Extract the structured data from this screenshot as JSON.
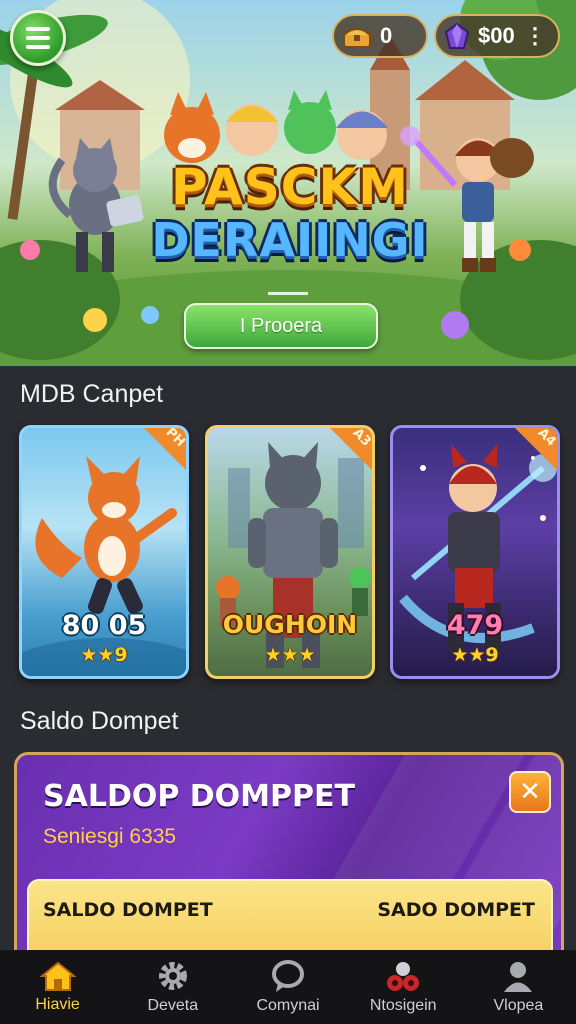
{
  "header": {
    "currency_gold": {
      "icon": "treasure-chest-icon",
      "value": "0"
    },
    "currency_gem": {
      "icon": "gem-icon",
      "value": "$00"
    },
    "more_icon": "more-vertical-icon",
    "menu_icon": "hamburger-menu-icon"
  },
  "hero": {
    "title_line1": "PASCKM",
    "title_line2": "DERAIINGI",
    "cta_label": "I Prooera"
  },
  "section1": {
    "title": "MDB Canpet",
    "cards": [
      {
        "badge": "PH",
        "value": "80 05",
        "rating_text": "★★9",
        "character": "fox-hero"
      },
      {
        "badge": "A3",
        "value": "OUGHOIN",
        "rating_text": "★★★",
        "character": "armored-knight"
      },
      {
        "badge": "A4",
        "value": "479",
        "rating_text": "★★9",
        "character": "fire-warrior"
      }
    ]
  },
  "section2": {
    "title": "Saldo Dompet"
  },
  "wallet": {
    "title": "SALDOP DOMPPET",
    "subtitle": "Seniesgi 6335",
    "close_icon": "close-x-icon",
    "inner_left": "SALDO DOMPET",
    "inner_right": "SADO DOMPET"
  },
  "bottom_nav": [
    {
      "label": "Hiavie",
      "icon": "home-icon",
      "active": true
    },
    {
      "label": "Deveta",
      "icon": "gear-icon",
      "active": false
    },
    {
      "label": "Comynai",
      "icon": "chat-bubble-icon",
      "active": false
    },
    {
      "label": "Ntosigein",
      "icon": "cherries-icon",
      "active": false
    },
    {
      "label": "Vlopea",
      "icon": "user-icon",
      "active": false
    }
  ],
  "colors": {
    "accent_active": "#ffd23a",
    "cta_green": "#3ea83a",
    "wallet_purple": "#6a2fb0",
    "wallet_gold": "#f2c44a"
  }
}
